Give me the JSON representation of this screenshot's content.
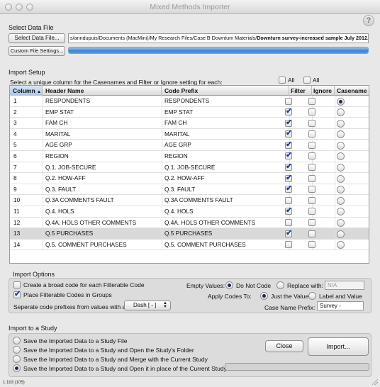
{
  "window": {
    "title": "Mixed Methods Importer"
  },
  "data_file": {
    "section_label": "Select Data File",
    "select_button": "Select Data File...",
    "path_prefix": "s/anndupuis/Documents (MacMini)/My Research Files/Case B Downtum Materials/",
    "path_file": "Downturn survey-increased sample July 2012.xlsx",
    "custom_button": "Custom File Settings...",
    "progress": 1.0
  },
  "import_setup": {
    "section_label": "Import Setup",
    "instruction": "Select a unique column for the Casenames and Filter or Ignore setting for each:",
    "all_label_1": "All",
    "all_label_2": "All",
    "headers": {
      "column": "Column",
      "header_name": "Header Name",
      "code_prefix": "Code Prefix",
      "filter": "Filter",
      "ignore": "Ignore",
      "casename": "Casename"
    },
    "rows": [
      {
        "col": "1",
        "name": "RESPONDENTS",
        "prefix": "RESPONDENTS",
        "filter": false,
        "ignore": false,
        "casename": true
      },
      {
        "col": "2",
        "name": "EMP STAT",
        "prefix": "EMP STAT",
        "filter": true,
        "ignore": false,
        "casename": false
      },
      {
        "col": "3",
        "name": "FAM CH",
        "prefix": "FAM CH",
        "filter": true,
        "ignore": false,
        "casename": false
      },
      {
        "col": "4",
        "name": "MARITAL",
        "prefix": "MARITAL",
        "filter": true,
        "ignore": false,
        "casename": false
      },
      {
        "col": "5",
        "name": "AGE GRP",
        "prefix": "AGE GRP",
        "filter": true,
        "ignore": false,
        "casename": false
      },
      {
        "col": "6",
        "name": "REGION",
        "prefix": "REGION",
        "filter": true,
        "ignore": false,
        "casename": false
      },
      {
        "col": "7",
        "name": "Q.1. JOB-SECURE",
        "prefix": "Q.1. JOB-SECURE",
        "filter": true,
        "ignore": false,
        "casename": false
      },
      {
        "col": "8",
        "name": "Q.2. HOW-AFF",
        "prefix": "Q.2. HOW-AFF",
        "filter": true,
        "ignore": false,
        "casename": false
      },
      {
        "col": "9",
        "name": "Q.3. FAULT",
        "prefix": "Q.3. FAULT",
        "filter": true,
        "ignore": false,
        "casename": false
      },
      {
        "col": "10",
        "name": "Q.3A COMMENTS FAULT",
        "prefix": "Q.3A COMMENTS FAULT",
        "filter": false,
        "ignore": false,
        "casename": false
      },
      {
        "col": "11",
        "name": "Q.4. HOLS",
        "prefix": "Q.4. HOLS",
        "filter": true,
        "ignore": false,
        "casename": false
      },
      {
        "col": "12",
        "name": "Q.4A. HOLS OTHER COMMENTS",
        "prefix": "Q.4A.  HOLS OTHER COMMENTS",
        "filter": false,
        "ignore": false,
        "casename": false
      },
      {
        "col": "13",
        "name": "Q.5 PURCHASES",
        "prefix": "Q.5 PURCHASES",
        "filter": true,
        "ignore": false,
        "casename": false
      },
      {
        "col": "14",
        "name": "Q.5. COMMENT PURCHASES",
        "prefix": "Q.5. COMMENT PURCHASES",
        "filter": false,
        "ignore": false,
        "casename": false
      }
    ]
  },
  "import_options": {
    "section_label": "Import Options",
    "broad_code_label": "Create a broad code for each Filterable Code",
    "broad_code_checked": false,
    "groups_label": "Place Filterable Codes in Groups",
    "groups_checked": true,
    "separate_label": "Seperate code prefixes from values with a:",
    "separator_value": "Dash [ - ]",
    "empty_values_label": "Empty Values:",
    "do_not_code_label": "Do Not Code",
    "replace_with_label": "Replace with:",
    "replace_placeholder": "N/A",
    "apply_codes_label": "Apply Codes To:",
    "just_value_label": "Just the Value",
    "label_and_value_label": "Label and Value",
    "case_name_prefix_label": "Case Name Prefix:",
    "case_name_prefix_value": "Survey -"
  },
  "import_to_study": {
    "section_label": "Import to a Study",
    "options": [
      {
        "label": "Save the Imported Data to a Study File",
        "selected": false
      },
      {
        "label": "Save the Imported Data to a Study and Open the Study's Folder",
        "selected": false
      },
      {
        "label": "Save the Imported Data to a Study and Merge with the Current Study",
        "selected": false
      },
      {
        "label": "Save the Imported Data to a Study and Open it in place of the Current Study",
        "selected": true
      }
    ],
    "close_button": "Close",
    "import_button": "Import..."
  },
  "status": {
    "version": "1.1b3 (105)"
  }
}
